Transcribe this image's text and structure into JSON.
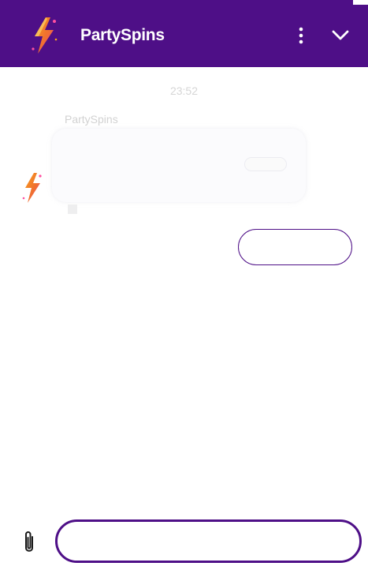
{
  "app": {
    "title": "PartySpins"
  },
  "header": {
    "title": "PartySpins",
    "logo_icon": "lightning-bolt-icon",
    "menu_icon": "vertical-dots-icon",
    "collapse_icon": "chevron-down-icon",
    "background_color": "#4e0f87"
  },
  "chat": {
    "timestamp": "23:52",
    "sender": "PartySpins",
    "message": {
      "text": "",
      "meta_left": "",
      "meta_right": ""
    },
    "attachment_label": "",
    "reply_button_label": ""
  },
  "composer": {
    "placeholder": "",
    "attach_icon": "paperclip-icon"
  },
  "colors": {
    "brand": "#4e0f87",
    "logo_orange": "#f28a22",
    "logo_pink": "#e9478f"
  }
}
